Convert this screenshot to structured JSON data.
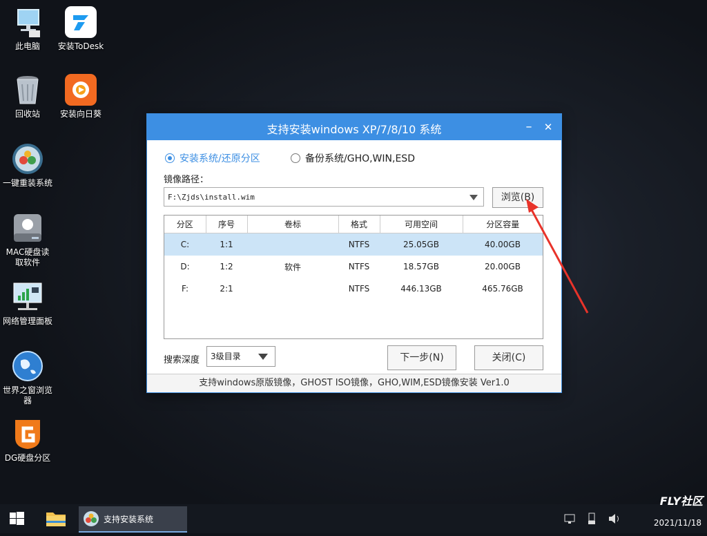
{
  "desktop": {
    "icons": [
      {
        "label": "此电脑"
      },
      {
        "label": "安装ToDesk"
      },
      {
        "label": "回收站"
      },
      {
        "label": "安装向日葵"
      },
      {
        "label": "一键重装系统"
      },
      {
        "label": "MAC硬盘读取软件"
      },
      {
        "label": "网络管理面板"
      },
      {
        "label": "世界之窗浏览器"
      },
      {
        "label": "DG硬盘分区"
      }
    ]
  },
  "window": {
    "title": "支持安装windows XP/7/8/10 系统",
    "min_label": "–",
    "close_label": "✕",
    "radio_install": "安装系统/还原分区",
    "radio_backup": "备份系统/GHO,WIN,ESD",
    "selected_mode": "install",
    "path_label": "镜像路径：",
    "path_value": "F:\\Zjds\\install.wim",
    "browse_label": "浏览(B)",
    "table": {
      "headers": [
        "分区",
        "序号",
        "卷标",
        "格式",
        "可用空间",
        "分区容量"
      ],
      "rows": [
        [
          "C:",
          "1:1",
          "",
          "NTFS",
          "25.05GB",
          "40.00GB"
        ],
        [
          "D:",
          "1:2",
          "软件",
          "NTFS",
          "18.57GB",
          "20.00GB"
        ],
        [
          "F:",
          "2:1",
          "",
          "NTFS",
          "446.13GB",
          "465.76GB"
        ]
      ],
      "selected_row": 0
    },
    "depth_label": "搜索深度",
    "depth_value": "3级目录",
    "next_label": "下一步(N)",
    "close_button_label": "关闭(C)",
    "status": "支持windows原版镜像，GHOST ISO镜像，GHO,WIM,ESD镜像安装 Ver1.0"
  },
  "taskbar": {
    "task_label": "支持安装系统",
    "clock": "2021/11/18",
    "watermark": "FLY社区"
  },
  "colors": {
    "accent": "#3d8fe3",
    "annotation": "#e8332a",
    "selected_row": "#cce4f7"
  }
}
